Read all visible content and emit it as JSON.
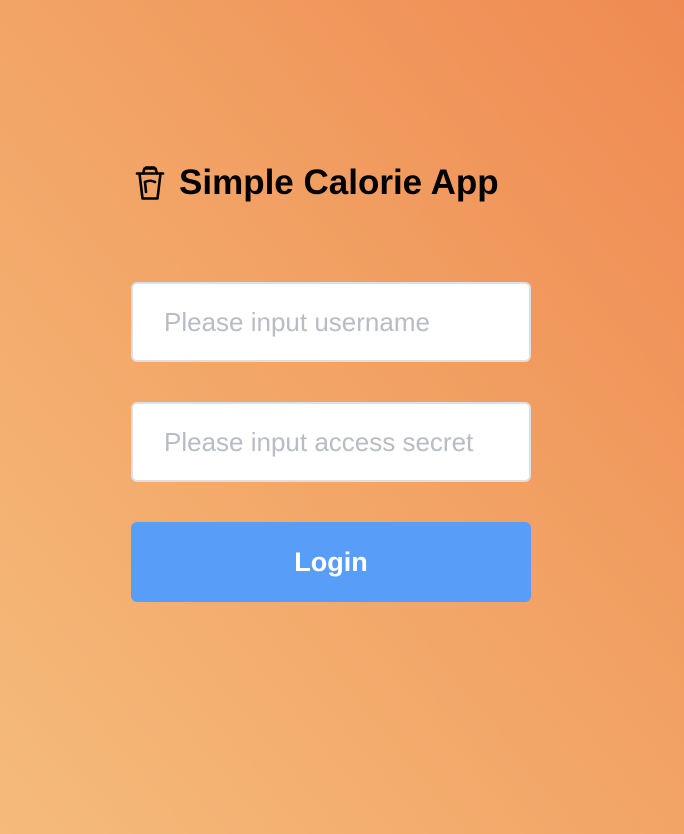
{
  "app": {
    "title": "Simple Calorie App",
    "logo_icon": "drink-cup-icon"
  },
  "login_form": {
    "username": {
      "value": "",
      "placeholder": "Please input username"
    },
    "access_secret": {
      "value": "",
      "placeholder": "Please input access secret"
    },
    "login_label": "Login"
  },
  "colors": {
    "background_gradient": [
      "#f5bb7b",
      "#ef8a53"
    ],
    "button_primary": "#589ef8",
    "input_border": "#dcdfe6",
    "placeholder_text": "#b8bcc4"
  }
}
